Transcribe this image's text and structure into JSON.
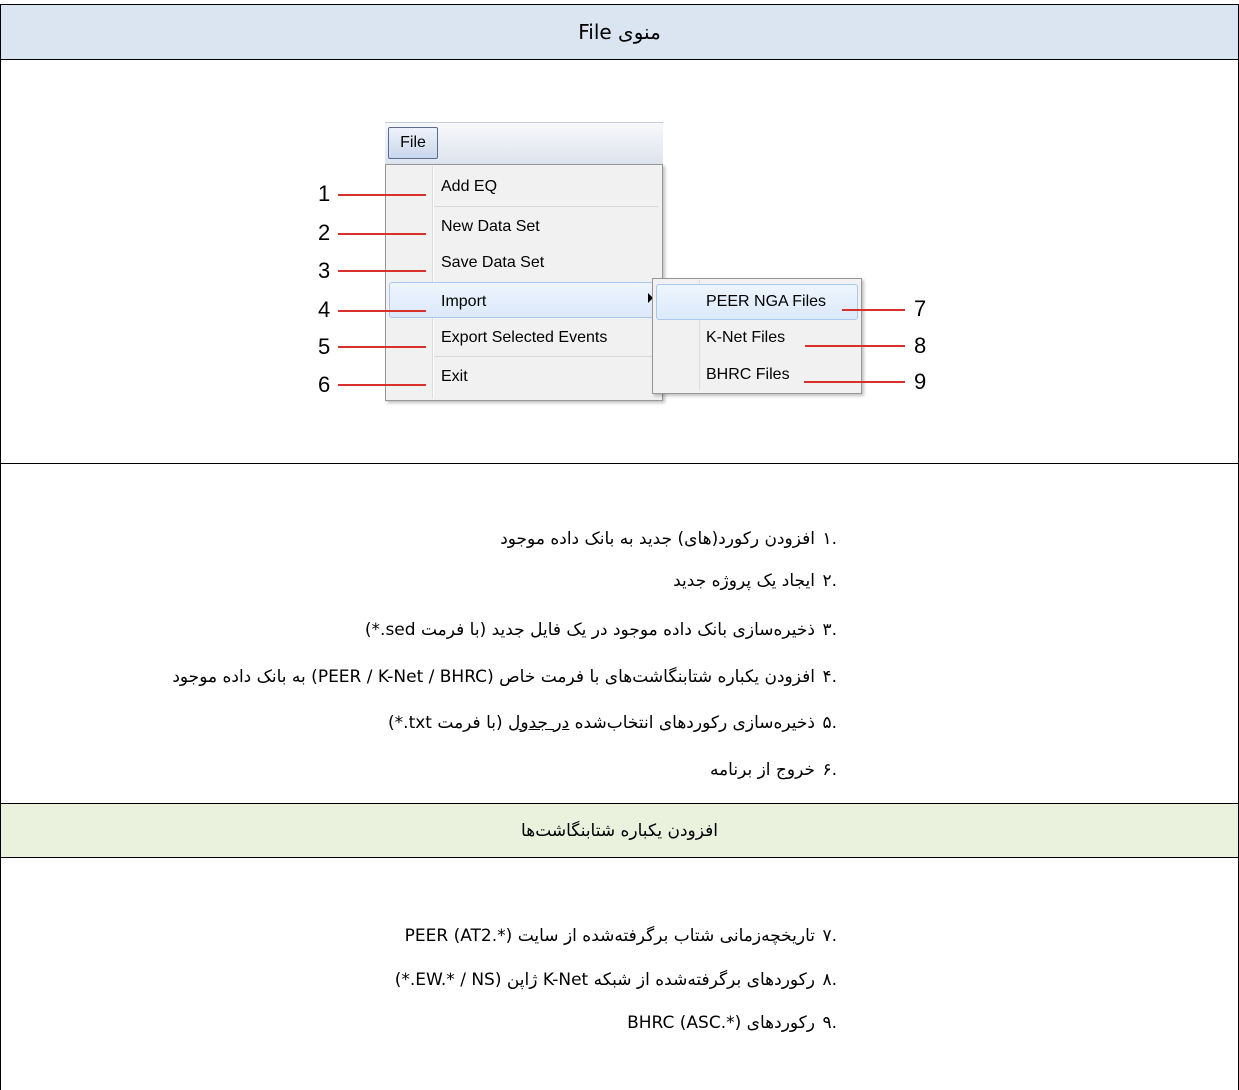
{
  "header": {
    "title": "منوی File"
  },
  "menu": {
    "file_label": "File",
    "items": [
      "Add EQ",
      "New Data Set",
      "Save Data Set",
      "Import",
      "Export Selected Events",
      "Exit"
    ],
    "submenu": [
      "PEER NGA Files",
      "K-Net Files",
      "BHRC Files"
    ],
    "callouts": [
      "1",
      "2",
      "3",
      "4",
      "5",
      "6",
      "7",
      "8",
      "9"
    ]
  },
  "list1": [
    {
      "num": ".۱",
      "text": "افزودن رکورد(های) جدید به بانک داده موجود"
    },
    {
      "num": ".۲",
      "text": "ایجاد یک پروژه جدید"
    },
    {
      "num": ".۳",
      "text": "ذخیره‌سازی بانک داده موجود در یک فایل جدید (با فرمت sed.*)"
    },
    {
      "num": ".۴",
      "text": "افزودن یکباره شتابنگاشت‌های با فرمت خاص (PEER / K-Net / BHRC) به بانک داده موجود"
    },
    {
      "num": ".۵",
      "text_a": "ذخیره‌سازی رکوردهای انتخاب‌شده ",
      "text_u": "در جدول",
      "text_b": " (با فرمت txt.*)"
    },
    {
      "num": ".۶",
      "text": "خروج از برنامه"
    }
  ],
  "section2": {
    "title": "افزودن یکباره شتابنگاشت‌ها"
  },
  "list2": [
    {
      "num": ".۷",
      "text": "تاریخچه‌زمانی شتاب برگرفته‌شده از سایت PEER (AT2.*)"
    },
    {
      "num": ".۸",
      "text": "رکوردهای برگرفته‌شده از شبکه K-Net ژاپن (EW.* / NS.*)"
    },
    {
      "num": ".۹",
      "text": "رکوردهای BHRC (ASC.*)"
    }
  ]
}
